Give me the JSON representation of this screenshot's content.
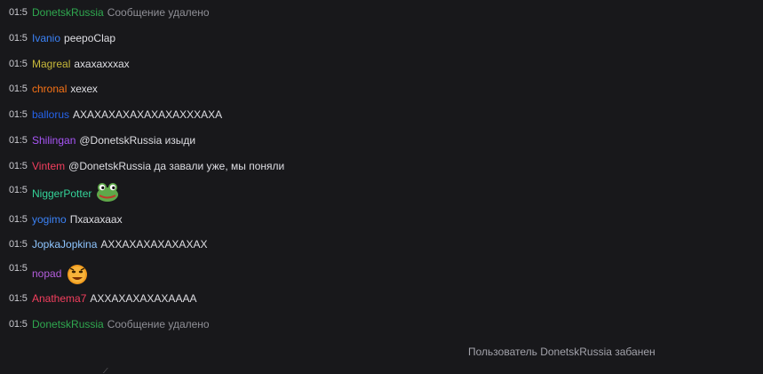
{
  "timestamp": "01:5",
  "messages": [
    {
      "user": "DonetskRussia",
      "color": "#2fa84f",
      "text": "Сообщение удалено",
      "deleted": true
    },
    {
      "user": "Ivanio",
      "color": "#3b82f6",
      "text": "peepoClap"
    },
    {
      "user": "Magreal",
      "color": "#c8b93a",
      "text": "ахахахххах"
    },
    {
      "user": "chronal",
      "color": "#f97316",
      "text": "хехех"
    },
    {
      "user": "ballorus",
      "color": "#2563eb",
      "text": "АХАХАХАХАХАХАХАХХХАХА"
    },
    {
      "user": "Shilingan",
      "color": "#a855f7",
      "text": "@DonetskRussia изыди"
    },
    {
      "user": "Vintem",
      "color": "#f43f5e",
      "text": "@DonetskRussia да завали уже, мы поняли"
    },
    {
      "user": "NiggerPotter",
      "color": "#34d399",
      "text": "",
      "emote": "frog-emote"
    },
    {
      "user": "yogimo",
      "color": "#3b82f6",
      "text": "Пхахахаах"
    },
    {
      "user": "JopkaJopkina",
      "color": "#8ec5ff",
      "text": "АХХАХАХАХАХАХАХ"
    },
    {
      "user": "nopad",
      "color": "#b45edc",
      "text": "",
      "emote": "orange-face-emote"
    },
    {
      "user": "Anathema7",
      "color": "#f43f5e",
      "text": "АХХАХАХАХАХАААА"
    },
    {
      "user": "DonetskRussia",
      "color": "#2fa84f",
      "text": "Сообщение удалено",
      "deleted": true
    }
  ],
  "system_notice": "Пользователь DonetskRussia забанен"
}
